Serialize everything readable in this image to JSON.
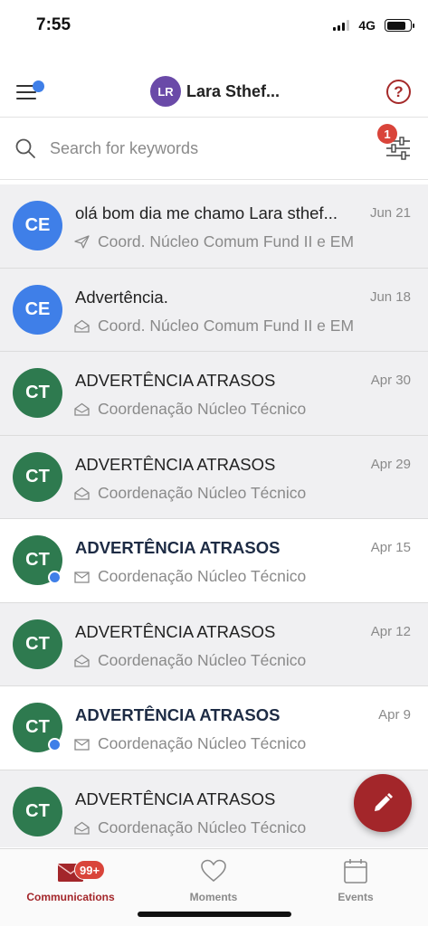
{
  "status_bar": {
    "time": "7:55",
    "network": "4G",
    "battery_level": 0.85
  },
  "header": {
    "profile_initials": "LR",
    "profile_name": "Lara Sthef...",
    "help_label": "?",
    "menu_has_notification": true
  },
  "search": {
    "placeholder": "Search for keywords",
    "value": "",
    "filter_count": "1"
  },
  "messages": [
    {
      "initials": "CE",
      "avatar_color": "#3f7fe8",
      "subject": "olá bom dia me chamo Lara sthef...",
      "sender": "Coord. Núcleo Comum Fund II e EM",
      "date": "Jun 21",
      "status": "sent",
      "unread": false
    },
    {
      "initials": "CE",
      "avatar_color": "#3f7fe8",
      "subject": "Advertência.",
      "sender": "Coord. Núcleo Comum Fund II e EM",
      "date": "Jun 18",
      "status": "opened",
      "unread": false
    },
    {
      "initials": "CT",
      "avatar_color": "#2e7a4f",
      "subject": "ADVERTÊNCIA ATRASOS",
      "sender": "Coordenação Núcleo Técnico",
      "date": "Apr 30",
      "status": "opened",
      "unread": false
    },
    {
      "initials": "CT",
      "avatar_color": "#2e7a4f",
      "subject": "ADVERTÊNCIA ATRASOS",
      "sender": "Coordenação Núcleo Técnico",
      "date": "Apr 29",
      "status": "opened",
      "unread": false
    },
    {
      "initials": "CT",
      "avatar_color": "#2e7a4f",
      "subject": "ADVERTÊNCIA ATRASOS",
      "sender": "Coordenação Núcleo Técnico",
      "date": "Apr 15",
      "status": "closed",
      "unread": true
    },
    {
      "initials": "CT",
      "avatar_color": "#2e7a4f",
      "subject": "ADVERTÊNCIA ATRASOS",
      "sender": "Coordenação Núcleo Técnico",
      "date": "Apr 12",
      "status": "opened",
      "unread": false
    },
    {
      "initials": "CT",
      "avatar_color": "#2e7a4f",
      "subject": "ADVERTÊNCIA ATRASOS",
      "sender": "Coordenação Núcleo Técnico",
      "date": "Apr 9",
      "status": "closed",
      "unread": true
    },
    {
      "initials": "CT",
      "avatar_color": "#2e7a4f",
      "subject": "ADVERTÊNCIA ATRASOS",
      "sender": "Coordenação Núcleo Técnico",
      "date": "",
      "status": "opened",
      "unread": false
    }
  ],
  "fab": {
    "icon": "pencil-icon"
  },
  "tabs": [
    {
      "label": "Communications",
      "icon": "envelope-icon",
      "badge": "99+",
      "active": true
    },
    {
      "label": "Moments",
      "icon": "heart-icon",
      "active": false
    },
    {
      "label": "Events",
      "icon": "calendar-icon",
      "active": false
    }
  ],
  "colors": {
    "accent": "#a3262a",
    "unread_dot": "#3f7fe8",
    "badge": "#d9443a"
  }
}
